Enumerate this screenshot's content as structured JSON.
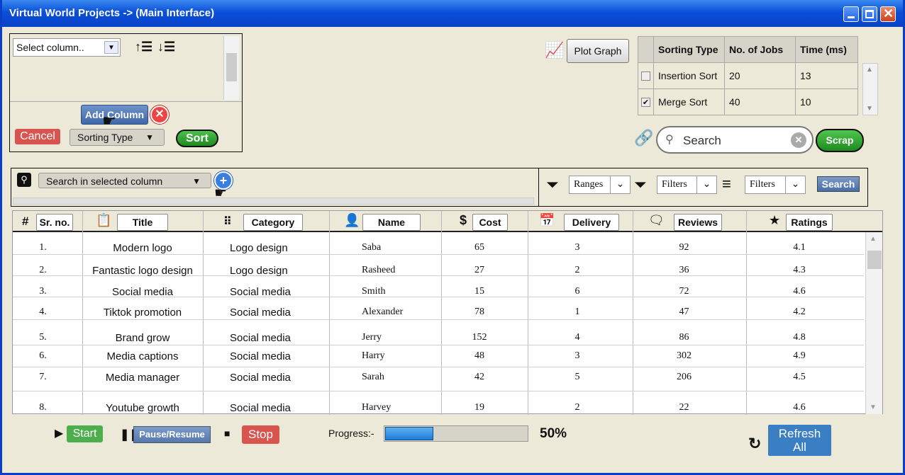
{
  "window": {
    "title": "Virtual World Projects -> (Main Interface)"
  },
  "column_panel": {
    "select_value": "Select column..",
    "add_column_label": "Add Column",
    "cancel_label": "Cancel",
    "sorting_type_label": "Sorting Type",
    "sort_label": "Sort"
  },
  "graph": {
    "plot_label": "Plot Graph"
  },
  "sort_table": {
    "headers": [
      "Sorting Type",
      "No. of Jobs",
      "Time (ms)"
    ],
    "rows": [
      {
        "name": "Insertion Sort",
        "jobs": "20",
        "time": "13",
        "checked": false
      },
      {
        "name": "Merge Sort",
        "jobs": "40",
        "time": "10",
        "checked": true
      }
    ]
  },
  "search": {
    "placeholder": "Search",
    "scrap_label": "Scrap"
  },
  "column_search": {
    "label": "Search in selected column"
  },
  "filters": {
    "ranges_label": "Ranges",
    "filters1_label": "Filters",
    "filters2_label": "Filters",
    "search_label": "Search"
  },
  "main_table": {
    "headers": {
      "num": "#",
      "srno": "Sr. no.",
      "title": "Title",
      "category": "Category",
      "name": "Name",
      "cost": "Cost",
      "delivery": "Delivery",
      "reviews": "Reviews",
      "ratings": "Ratings"
    },
    "rows": [
      {
        "sr": "1.",
        "title": "Modern logo",
        "category": "Logo design",
        "name": "Saba",
        "cost": "65",
        "delivery": "3",
        "reviews": "92",
        "rating": "4.1"
      },
      {
        "sr": "2.",
        "title": "Fantastic logo design",
        "category": "Logo design",
        "name": "Rasheed",
        "cost": "27",
        "delivery": "2",
        "reviews": "36",
        "rating": "4.3"
      },
      {
        "sr": "3.",
        "title": "Social media",
        "category": "Social media",
        "name": "Smith",
        "cost": "15",
        "delivery": "6",
        "reviews": "72",
        "rating": "4.6"
      },
      {
        "sr": "4.",
        "title": "Tiktok promotion",
        "category": "Social media",
        "name": "Alexander",
        "cost": "78",
        "delivery": "1",
        "reviews": "47",
        "rating": "4.2"
      },
      {
        "sr": "5.",
        "title": "Brand grow",
        "category": "Social media",
        "name": "Jerry",
        "cost": "152",
        "delivery": "4",
        "reviews": "86",
        "rating": "4.8"
      },
      {
        "sr": "6.",
        "title": "Media captions",
        "category": "Social media",
        "name": "Harry",
        "cost": "48",
        "delivery": "3",
        "reviews": "302",
        "rating": "4.9"
      },
      {
        "sr": "7.",
        "title": "Media manager",
        "category": "Social media",
        "name": "Sarah",
        "cost": "42",
        "delivery": "5",
        "reviews": "206",
        "rating": "4.5"
      },
      {
        "sr": "8.",
        "title": "Youtube growth",
        "category": "Social media",
        "name": "Harvey",
        "cost": "19",
        "delivery": "2",
        "reviews": "22",
        "rating": "4.6"
      }
    ]
  },
  "controls": {
    "start_label": "Start",
    "pause_label": "Pause/Resume",
    "stop_label": "Stop",
    "progress_label": "Progress:-",
    "progress_value": 0.5,
    "progress_text": "50%",
    "refresh_line1": "Refresh",
    "refresh_line2": "All"
  },
  "colors": {
    "title_bar": "#0a4fd8",
    "start": "#4cae4c",
    "stop": "#d9534f",
    "refresh": "#3a7fc4",
    "sort_button": "#1e8a1e"
  }
}
